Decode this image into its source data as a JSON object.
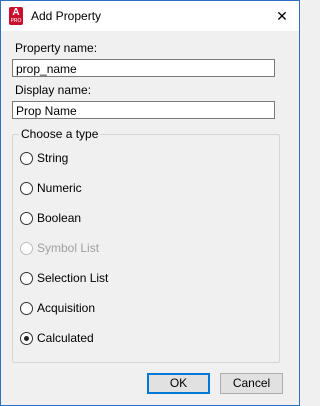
{
  "window": {
    "title": "Add Property",
    "close_glyph": "✕",
    "icon_letter": "A",
    "icon_subtext": "PRO"
  },
  "form": {
    "property_name_label": "Property name:",
    "property_name_value": "prop_name",
    "display_name_label": "Display name:",
    "display_name_value": "Prop Name"
  },
  "type_group": {
    "caption": "Choose a type",
    "selected": "Calculated",
    "options": [
      {
        "label": "String",
        "enabled": true
      },
      {
        "label": "Numeric",
        "enabled": true
      },
      {
        "label": "Boolean",
        "enabled": true
      },
      {
        "label": "Symbol List",
        "enabled": false
      },
      {
        "label": "Selection List",
        "enabled": true
      },
      {
        "label": "Acquisition",
        "enabled": true
      },
      {
        "label": "Calculated",
        "enabled": true
      }
    ]
  },
  "buttons": {
    "ok": "OK",
    "cancel": "Cancel"
  }
}
